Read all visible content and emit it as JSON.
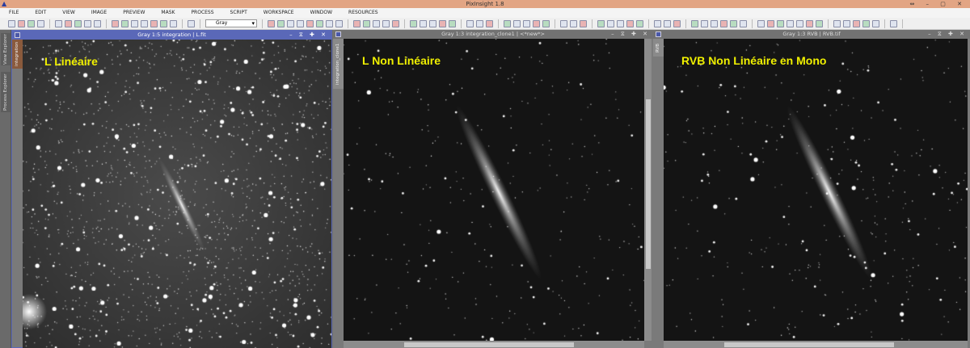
{
  "app": {
    "title": "PixInsight 1.8"
  },
  "menu": [
    "FILE",
    "EDIT",
    "VIEW",
    "IMAGE",
    "PREVIEW",
    "MASK",
    "PROCESS",
    "SCRIPT",
    "WORKSPACE",
    "WINDOW",
    "RESOURCES"
  ],
  "toolbar": {
    "view_select": "Gray"
  },
  "dock": {
    "tabs": [
      "View Explorer",
      "Process Explorer"
    ]
  },
  "windows": [
    {
      "title": "Gray 1:5 integration | L.fit",
      "tab": "integration",
      "label": "L Linéaire",
      "active": true
    },
    {
      "title": "Gray 1:3 integration_clone1 | <*new*>",
      "tab": "integration_clone1",
      "label": "L Non Linéaire",
      "active": false
    },
    {
      "title": "Gray 1:3 RVB | RVB.tif",
      "tab": "RVB",
      "label": "RVB Non Linéaire en Mono",
      "active": false
    }
  ],
  "colors": {
    "title_bar": "#e2a584",
    "active_window": "#5a68b8",
    "label": "#f0f000"
  }
}
